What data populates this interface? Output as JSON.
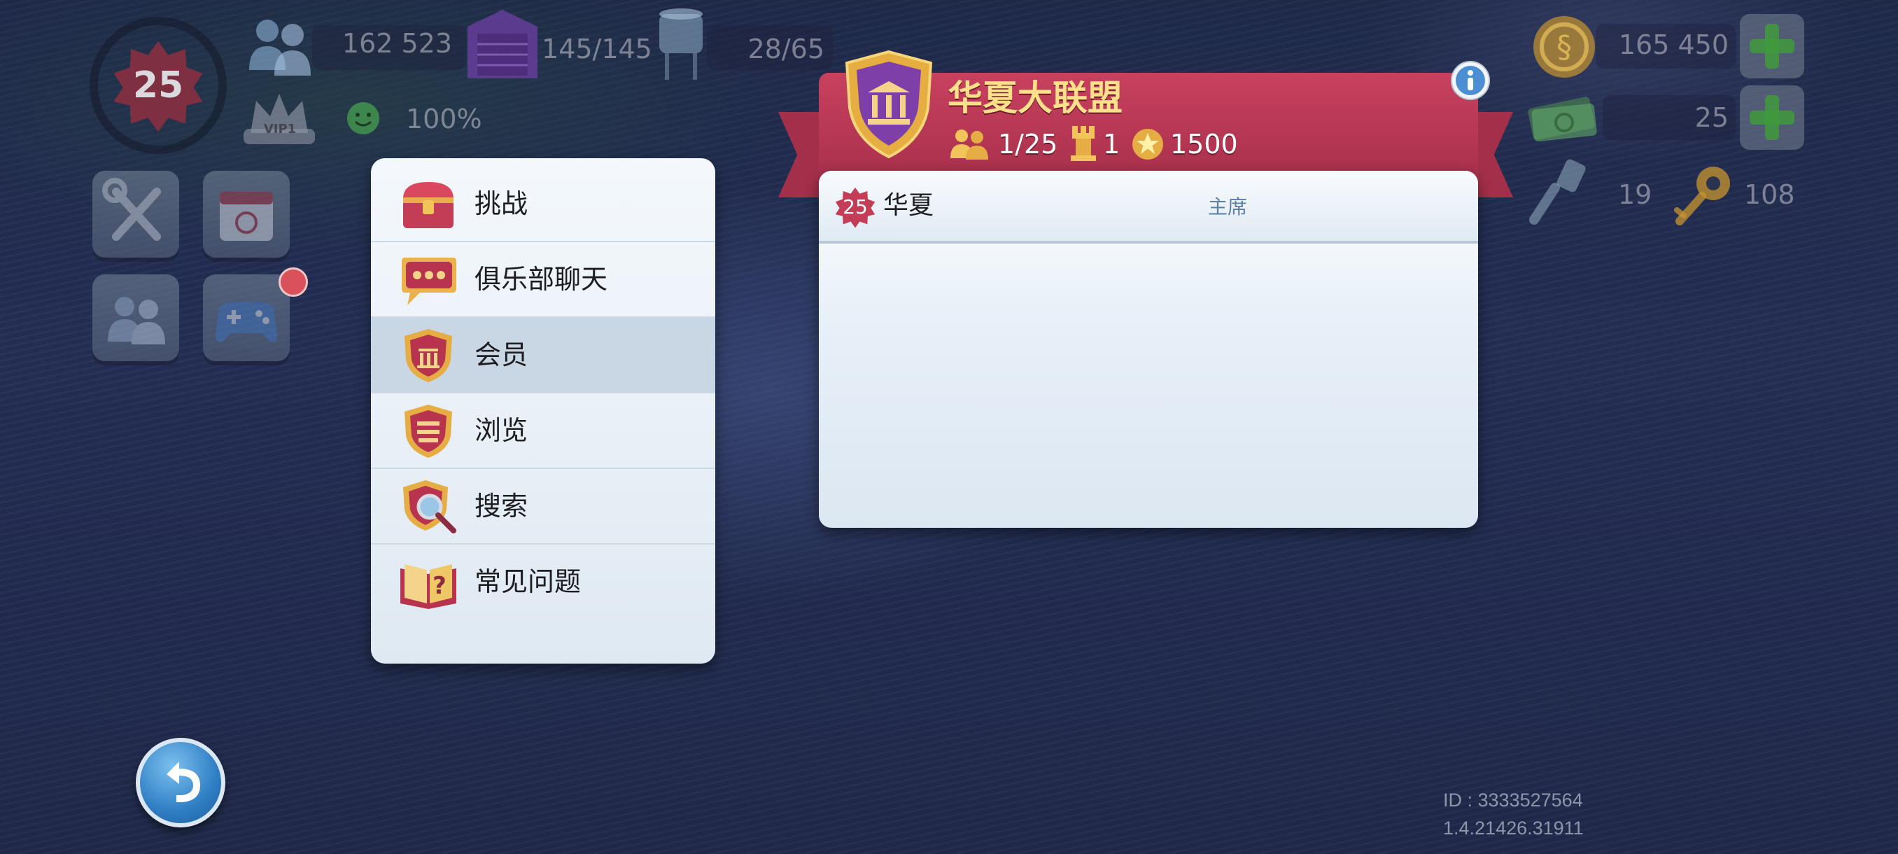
{
  "hud": {
    "level": "25",
    "population": "162 523",
    "storage": "145/145",
    "water": "28/65",
    "happiness": "100%",
    "vip_label": "VIP1",
    "simoleons": "165 450",
    "simcash": "25",
    "golden_keys": "19",
    "neo_keys": "108"
  },
  "menu": {
    "items": [
      {
        "label": "挑战",
        "icon": "chest-icon"
      },
      {
        "label": "俱乐部聊天",
        "icon": "chat-icon"
      },
      {
        "label": "会员",
        "icon": "club-shield-icon"
      },
      {
        "label": "浏览",
        "icon": "browse-shield-icon"
      },
      {
        "label": "搜索",
        "icon": "search-shield-icon"
      },
      {
        "label": "常见问题",
        "icon": "faq-book-icon"
      }
    ],
    "active_index": 2
  },
  "club": {
    "name": "华夏大联盟",
    "members": "1/25",
    "wars": "1",
    "points": "1500",
    "member_list": [
      {
        "level": "25",
        "name": "华夏",
        "role": "主席"
      }
    ]
  },
  "footer": {
    "id": "ID : 3333527564",
    "version": "1.4.21426.31911"
  },
  "colors": {
    "ribbon": "#b8374f",
    "title_gold": "#ffe08a",
    "menu_active": "#c9d7e4"
  }
}
